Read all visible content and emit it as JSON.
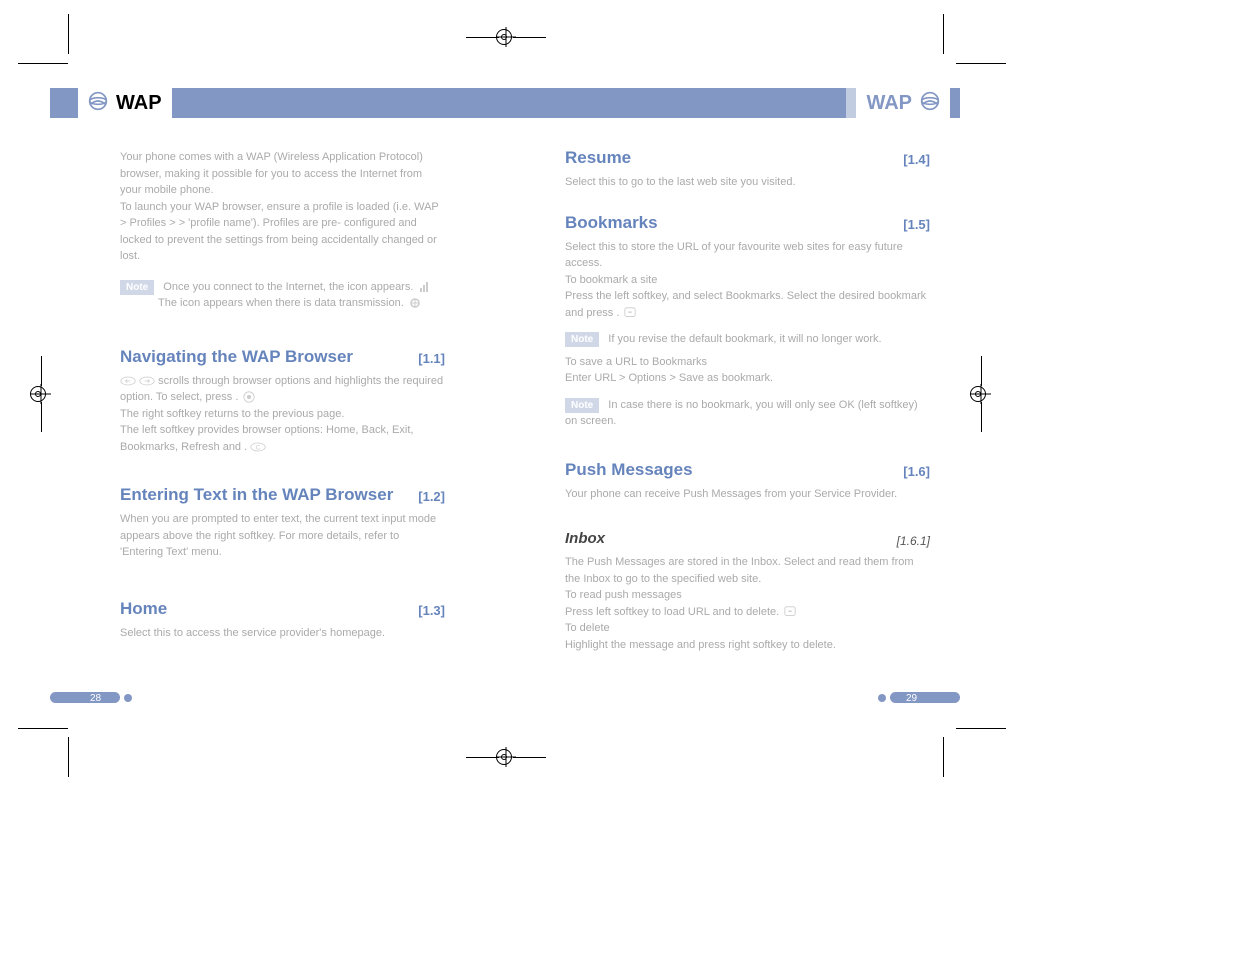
{
  "header": {
    "left_label": "WAP",
    "right_label": "WAP"
  },
  "left_column": {
    "intro_line1": "Your phone comes with a WAP (Wireless Application",
    "intro_line2": "Protocol) browser, making it possible for you to access the",
    "intro_line3": "Internet from your mobile phone.",
    "intro_line4": "To launch your WAP browser, ensure a profile is loaded",
    "intro_line5": "(i.e. WAP > Profiles > > 'profile name'). Profiles are pre-",
    "intro_line6": "configured and locked to prevent the settings from being",
    "intro_line7": "accidentally changed or lost.",
    "note1_prefix": "Note",
    "note1_text1": "Once you connect to the Internet, the icon appears.",
    "note1_text2": "The icon appears when there is data transmission.",
    "sections": [
      {
        "title": "Navigating the WAP Browser",
        "num": "[1.1]",
        "body1": "scrolls through browser options and highlights the required",
        "body2": "option. To select, press .",
        "body3": "The right softkey returns to the previous page.",
        "body4": "The left softkey provides browser options: Home, Back, Exit,",
        "body5": "Bookmarks, Refresh and ."
      },
      {
        "title": "Entering Text in the WAP Browser",
        "num": "[1.2]",
        "body": "When you are prompted to enter text, the current text input mode appears above the right softkey. For more details, refer to 'Entering Text' menu."
      },
      {
        "title": "Home",
        "num": "[1.3]",
        "body": "Select this to access the service provider's homepage."
      }
    ]
  },
  "right_column": {
    "sections": [
      {
        "title": "Resume",
        "num": "[1.4]",
        "body": "Select this to go to the last web site you visited."
      },
      {
        "title": "Bookmarks",
        "num": "[1.5]",
        "body1": "Select this to store the URL of your favourite web sites for easy future access.",
        "body2": "To bookmark a site",
        "body3": "Press the left softkey, and select Bookmarks. Select the desired bookmark and press .",
        "note_prefix": "Note",
        "note_text": "If you revise the default bookmark, it will no longer work.",
        "body4": "To save a URL to Bookmarks",
        "body5": "Enter URL > Options > Save as bookmark.",
        "note2_prefix": "Note",
        "note2_text": "In case there is no bookmark, you will only see OK (left softkey) on screen."
      },
      {
        "title": "Push Messages",
        "num": "[1.6]",
        "body": "Your phone can receive Push Messages from your Service Provider."
      }
    ],
    "subsection": {
      "title": "Inbox",
      "num": "[1.6.1]",
      "body1": "The Push Messages are stored in the Inbox. Select and read them from the Inbox to go to the specified web site.",
      "body2": "To read push messages",
      "body3": "Press left softkey to load URL and to delete.",
      "body4": "To delete",
      "body5": "Highlight the message and press right softkey to delete."
    }
  },
  "page_numbers": {
    "left": "28",
    "right": "29"
  }
}
